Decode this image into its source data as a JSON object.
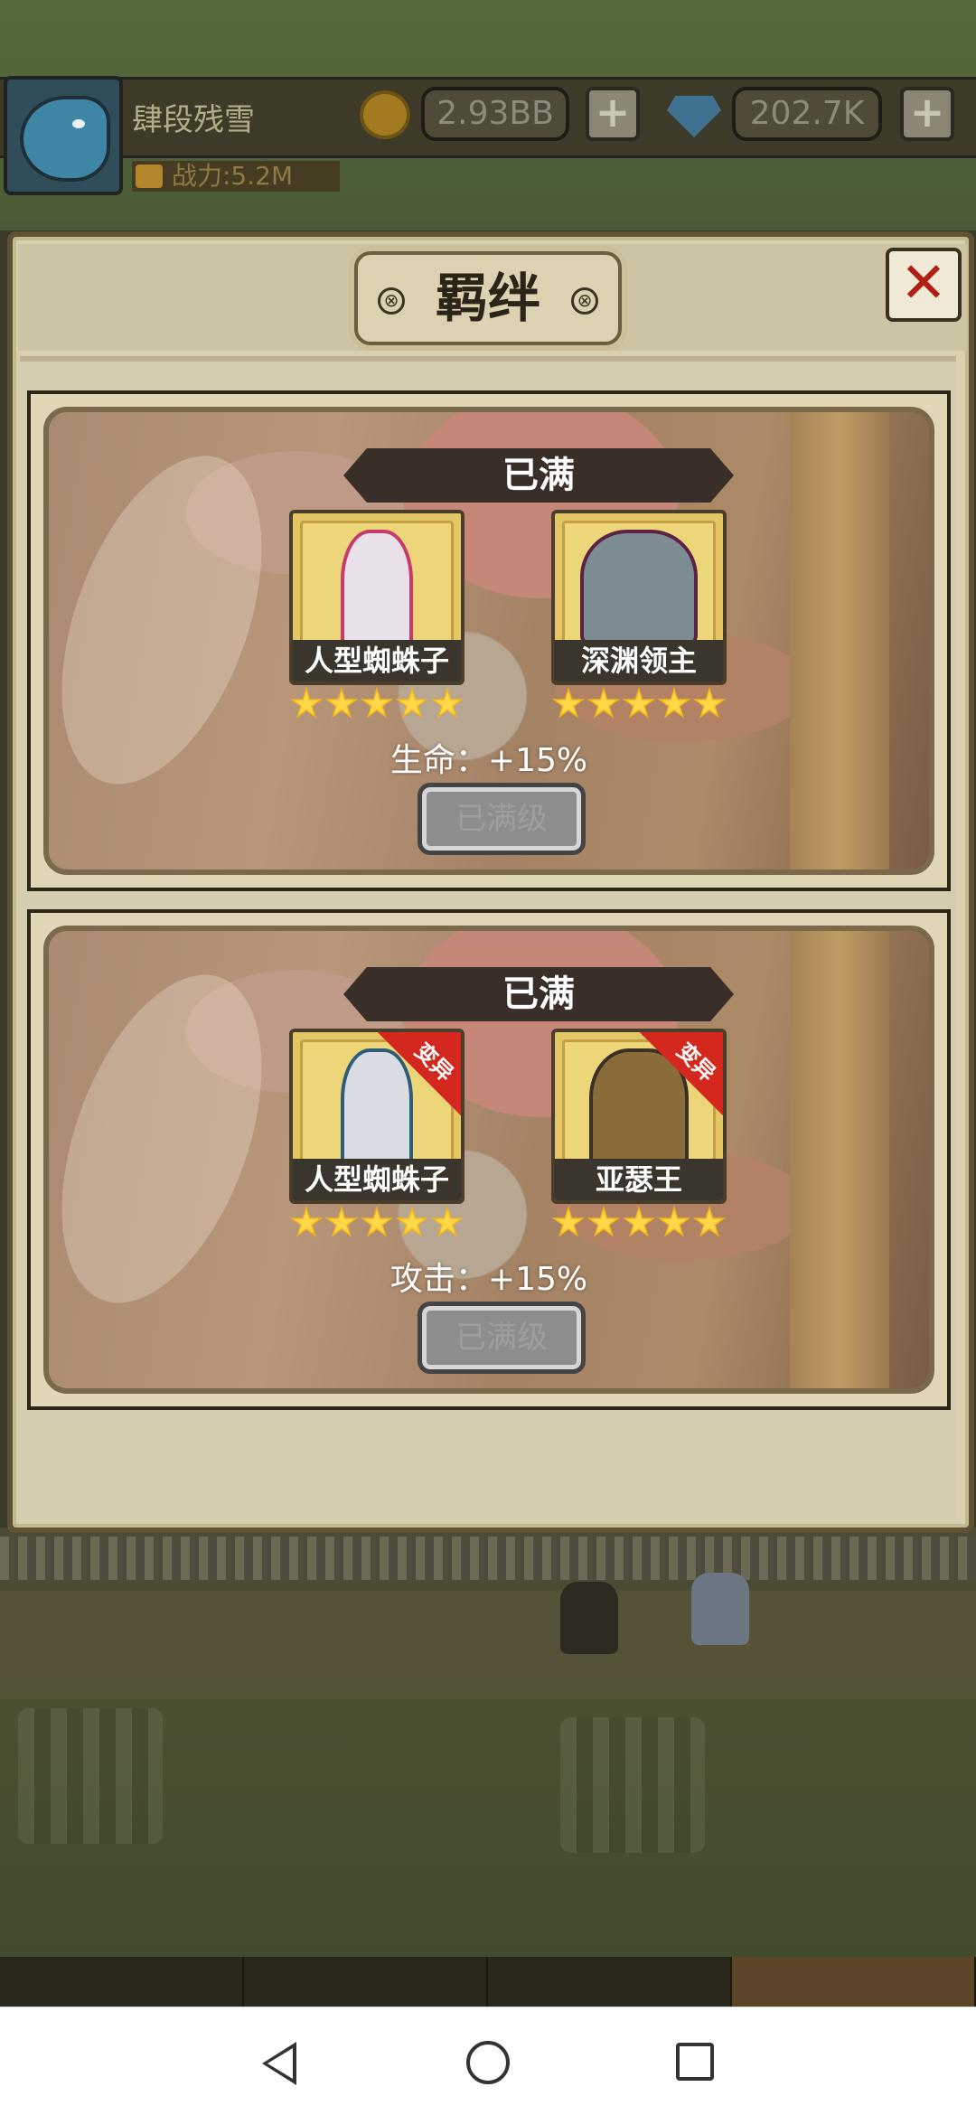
{
  "player": {
    "name": "肆段残雪",
    "power": "战力:5.2M",
    "gold": "2.93BB",
    "gems": "202.7K",
    "plus_label": "+"
  },
  "dialog": {
    "title": "羁绊",
    "close_label": "✕"
  },
  "bonds": [
    {
      "status": "已满",
      "heroes": [
        {
          "name": "人型蜘蛛子",
          "stars": 5,
          "mutated": false
        },
        {
          "name": "深渊领主",
          "stars": 5,
          "mutated": false
        }
      ],
      "bonus": "生命：+15%",
      "button": "已满级"
    },
    {
      "status": "已满",
      "heroes": [
        {
          "name": "人型蜘蛛子",
          "stars": 5,
          "mutated": true,
          "tag": "变异"
        },
        {
          "name": "亚瑟王",
          "stars": 5,
          "mutated": true,
          "tag": "变异"
        }
      ],
      "bonus": "攻击：+15%",
      "button": "已满级"
    }
  ],
  "colors": {
    "accent_red": "#d4281e",
    "star_gold": "#f3b51a",
    "panel_bg": "#d8cfae"
  }
}
